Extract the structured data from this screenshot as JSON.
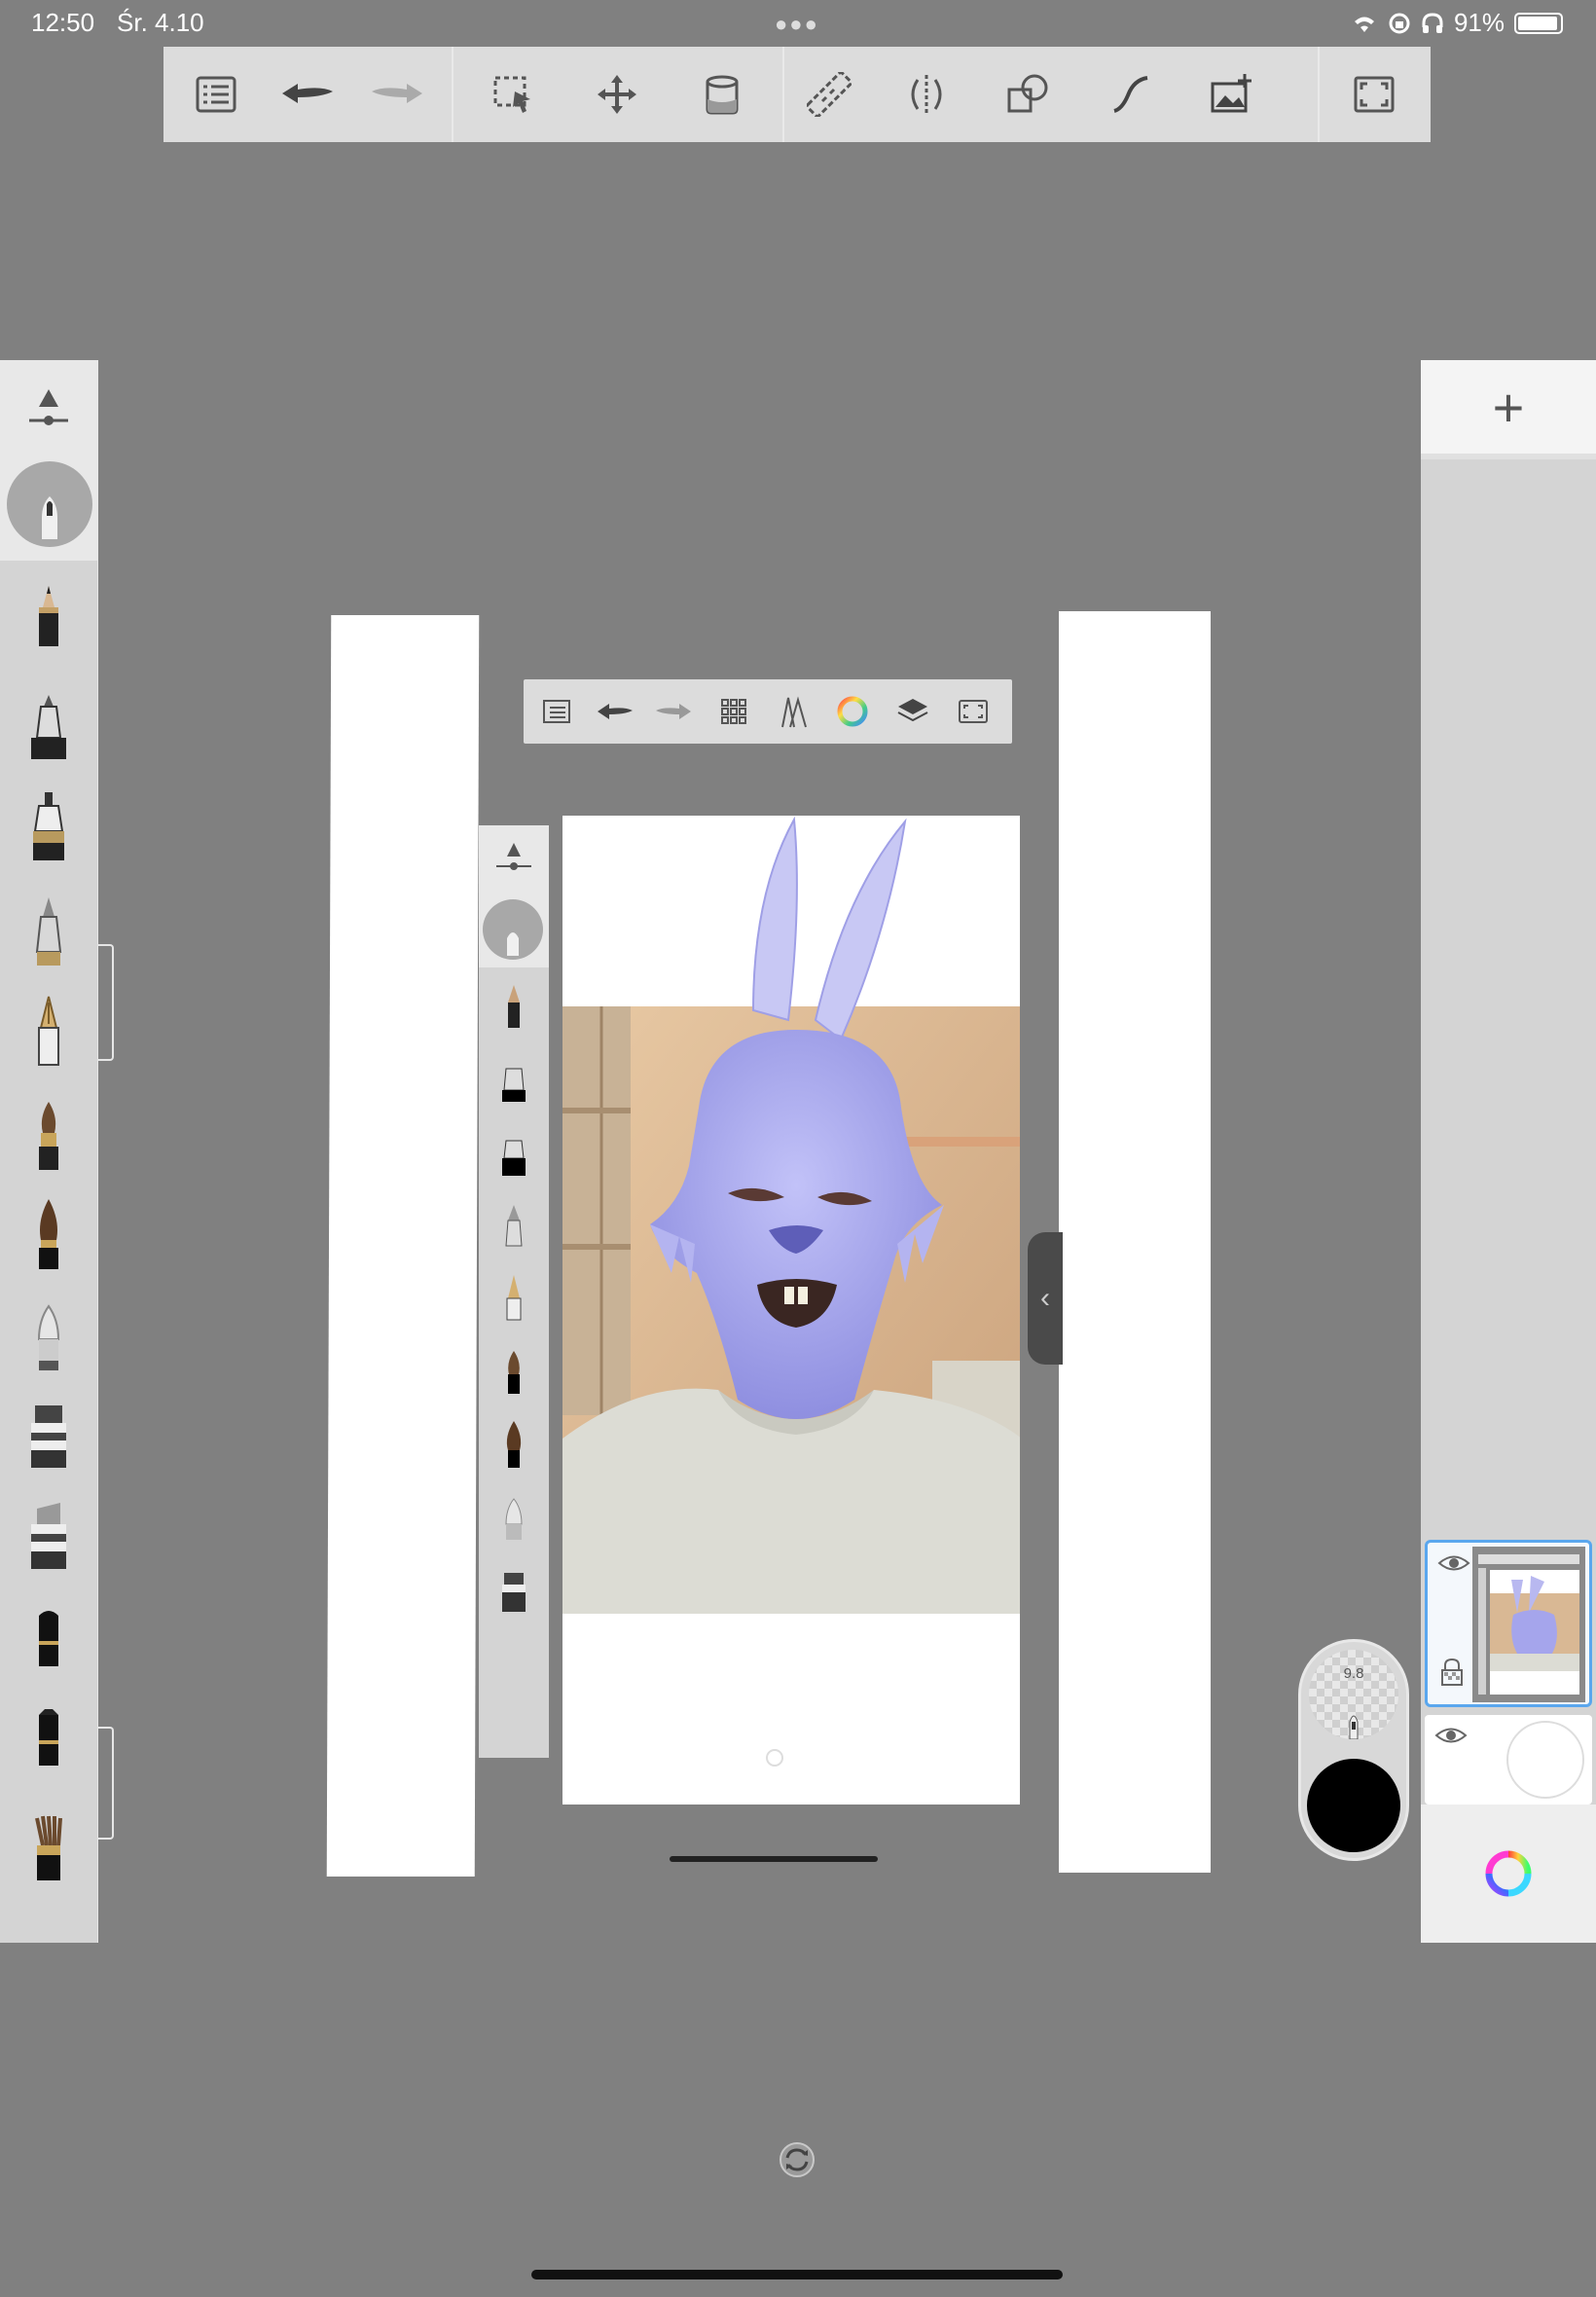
{
  "status_bar": {
    "time": "12:50",
    "date": "Śr. 4.10",
    "battery": "91%"
  },
  "toolbar": {
    "items": [
      "menu-icon",
      "undo-icon",
      "redo-icon",
      "selection-icon",
      "transform-icon",
      "fill-icon",
      "ruler-icon",
      "symmetry-icon",
      "shapes-icon",
      "curve-icon",
      "add-image-icon",
      "fullscreen-icon"
    ]
  },
  "brush_library": {
    "items": [
      "brush-properties",
      "current-brush",
      "pencil",
      "ballpoint",
      "fineliner",
      "marker",
      "fountain-pen",
      "paintbrush",
      "ink-brush",
      "airbrush",
      "chisel-marker",
      "flat-marker",
      "smudge",
      "eraser",
      "bristle-brush"
    ]
  },
  "layers_panel": {
    "add_label": "+",
    "layers": [
      {
        "name": "layer-1",
        "visible": true,
        "selected": true
      },
      {
        "name": "layer-2",
        "visible": true,
        "selected": false
      }
    ]
  },
  "color_puck": {
    "brush_size": "9.8",
    "color": "#000000"
  },
  "colors": {
    "background": "#808080",
    "toolbar": "#dcdcdc",
    "accent": "#5aa7ee",
    "mask": "#a9a9f0"
  }
}
